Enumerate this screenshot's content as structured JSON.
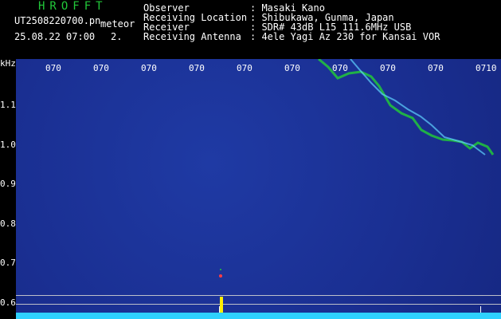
{
  "header": {
    "title": "HROFFT",
    "filename": "UT2508220700.pn",
    "meteor_label": "meteor",
    "datetime": "25.08.22 07:00",
    "count": "2."
  },
  "metadata": [
    {
      "label": "Observer",
      "value": ": Masaki Kano"
    },
    {
      "label": "Receiving Location",
      "value": ": Shibukawa, Gunma, Japan"
    },
    {
      "label": "Receiver",
      "value": ": SDR# 43dB L15 111.6MHz USB"
    },
    {
      "label": "Receiving Antenna",
      "value": ": 4ele Yagi Az 230 for Kansai VOR"
    }
  ],
  "y_axis": {
    "unit": "kHz",
    "ticks": [
      "1.1",
      "1.0",
      "0.9",
      "0.8",
      "0.7",
      "0.6"
    ]
  },
  "x_axis": {
    "ticks": [
      "070",
      "070",
      "070",
      "070",
      "070",
      "070",
      "070",
      "070",
      "070",
      "0710"
    ]
  },
  "colors": {
    "background": "#000000",
    "spectrogram": "#1f3aa4",
    "signal": "#22c83a",
    "noise_floor": "#2ed1ff",
    "spike": "#ffef00"
  }
}
